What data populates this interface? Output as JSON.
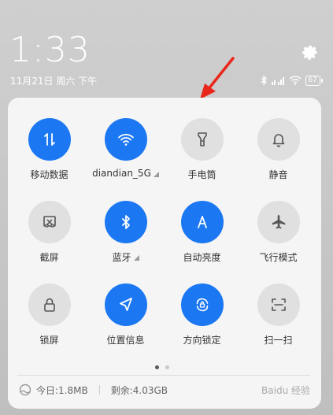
{
  "lockscreen": {
    "time": "1:33",
    "date": "11月21日 周六 下午",
    "battery": "67"
  },
  "tiles": [
    {
      "label": "移动数据",
      "icon": "mobile-data-icon",
      "on": true
    },
    {
      "label": "diandian_5G",
      "icon": "wifi-icon",
      "on": true,
      "more": true
    },
    {
      "label": "手电筒",
      "icon": "flashlight-icon",
      "on": false
    },
    {
      "label": "静音",
      "icon": "bell-icon",
      "on": false
    },
    {
      "label": "截屏",
      "icon": "screenshot-icon",
      "on": false
    },
    {
      "label": "蓝牙",
      "icon": "bluetooth-icon",
      "on": true,
      "more": true
    },
    {
      "label": "自动亮度",
      "icon": "auto-brightness-icon",
      "on": true
    },
    {
      "label": "飞行模式",
      "icon": "airplane-icon",
      "on": false
    },
    {
      "label": "锁屏",
      "icon": "lock-icon",
      "on": false
    },
    {
      "label": "位置信息",
      "icon": "location-icon",
      "on": true
    },
    {
      "label": "方向锁定",
      "icon": "rotation-lock-icon",
      "on": true
    },
    {
      "label": "扫一扫",
      "icon": "scan-icon",
      "on": false
    }
  ],
  "footer": {
    "today": "今日:1.8MB",
    "remaining": "剩余:4.03GB",
    "watermark": "Baidu 经验"
  },
  "colors": {
    "accent": "#1c78f2",
    "tile_off": "#e0e0e0"
  }
}
